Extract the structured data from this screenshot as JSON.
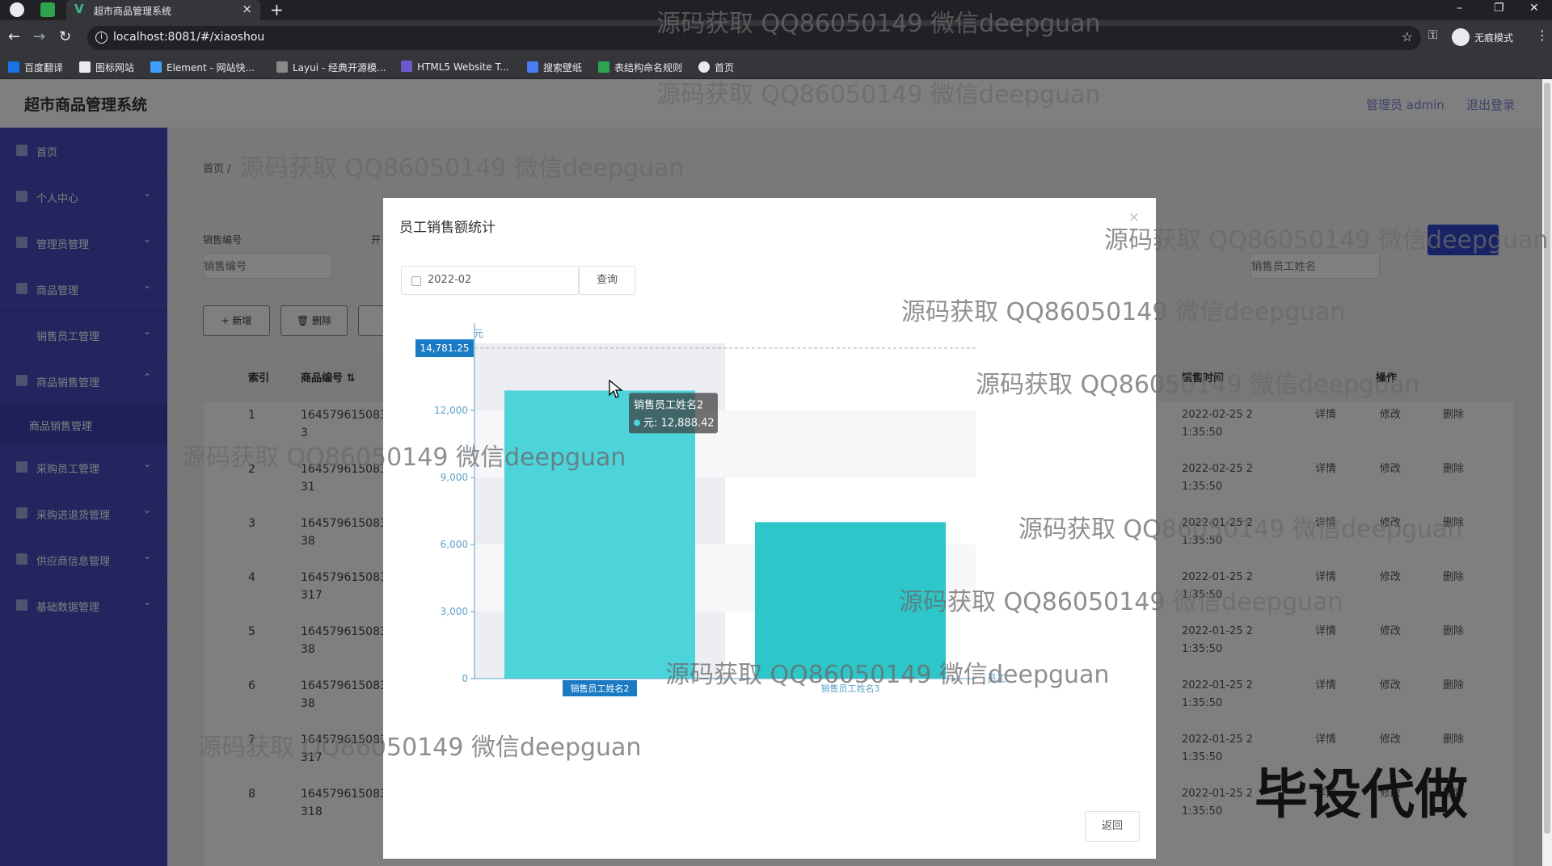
{
  "browser": {
    "tab_title": "超市商品管理系统",
    "url": "localhost:8081/#/xiaoshou",
    "profile_label": "无痕模式",
    "bookmarks": [
      "百度翻译",
      "图标网站",
      "Element - 网站快...",
      "Layui - 经典开源模...",
      "HTML5 Website T...",
      "搜索壁纸",
      "表结构命名规则",
      "首页"
    ]
  },
  "app": {
    "title": "超市商品管理系统",
    "user_label": "管理员 admin",
    "logout_label": "退出登录"
  },
  "sidebar": {
    "items": [
      {
        "label": "首页",
        "chevron": ""
      },
      {
        "label": "个人中心",
        "chevron": "⌄"
      },
      {
        "label": "管理员管理",
        "chevron": "⌄"
      },
      {
        "label": "商品管理",
        "chevron": "⌄"
      },
      {
        "label": "销售员工管理",
        "chevron": "⌄"
      },
      {
        "label": "商品销售管理",
        "chevron": "⌃"
      },
      {
        "label": "商品销售管理",
        "chevron": ""
      },
      {
        "label": "采购员工管理",
        "chevron": "⌄"
      },
      {
        "label": "采购进退货管理",
        "chevron": "⌄"
      },
      {
        "label": "供应商信息管理",
        "chevron": "⌄"
      },
      {
        "label": "基础数据管理",
        "chevron": "⌄"
      }
    ]
  },
  "main": {
    "breadcrumb": "首页 /",
    "filters": {
      "label1": "销售编号",
      "placeholder1": "销售编号",
      "label2": "销售员工姓名",
      "placeholder2": "销售员工姓名",
      "label3": "开"
    },
    "buttons": {
      "add": "+ 新增",
      "delete": "🗑 删除"
    },
    "table": {
      "headers": [
        "索引",
        "商品编号 ⇅",
        "销售时间",
        "操作"
      ],
      "rows": [
        {
          "index": "1",
          "code": "164579615083\n3",
          "time": "2022-02-25 2\n1:35:50"
        },
        {
          "index": "2",
          "code": "164579615083\n31",
          "time": "2022-02-25 2\n1:35:50"
        },
        {
          "index": "3",
          "code": "164579615083\n38",
          "time": "2022-01-25 2\n1:35:50"
        },
        {
          "index": "4",
          "code": "164579615083\n317",
          "time": "2022-01-25 2\n1:35:50"
        },
        {
          "index": "5",
          "code": "164579615083\n38",
          "time": "2022-01-25 2\n1:35:50"
        },
        {
          "index": "6",
          "code": "164579615083\n38",
          "time": "2022-01-25 2\n1:35:50"
        },
        {
          "index": "7",
          "code": "164579615083\n317",
          "time": "2022-01-25 2\n1:35:50"
        },
        {
          "index": "8",
          "code": "164579615083\n318",
          "time": "2022-01-25 2\n1:35:50"
        }
      ],
      "actions": {
        "detail": "详情",
        "edit": "修改",
        "delete": "删除"
      }
    }
  },
  "dialog": {
    "title": "员工销售额统计",
    "close": "×",
    "month_value": "2022-02",
    "query_label": "查询",
    "return_label": "返回",
    "tooltip": {
      "name": "销售员工姓名2",
      "line": "元: 12,888.42"
    },
    "max_label": "14,781.25"
  },
  "chart_data": {
    "type": "bar",
    "title": "",
    "xlabel": "员工",
    "ylabel": "元",
    "categories": [
      "销售员工姓名2",
      "销售员工姓名3"
    ],
    "values": [
      12888.42,
      7000
    ],
    "ylim": [
      0,
      15000
    ],
    "yticks": [
      0,
      3000,
      6000,
      9000,
      12000
    ],
    "ytick_labels": [
      "0",
      "3,000",
      "6,000",
      "9,000",
      "12,000"
    ],
    "max_marker": 14781.25,
    "colors": {
      "bar1": "#4dd4db",
      "bar2": "#2ec7c9",
      "axis": "#5aa0c8",
      "marker": "#1a7ac4"
    }
  },
  "watermarks": {
    "text": "源码获取 QQ86050149 微信deepguan",
    "big": "毕设代做"
  }
}
